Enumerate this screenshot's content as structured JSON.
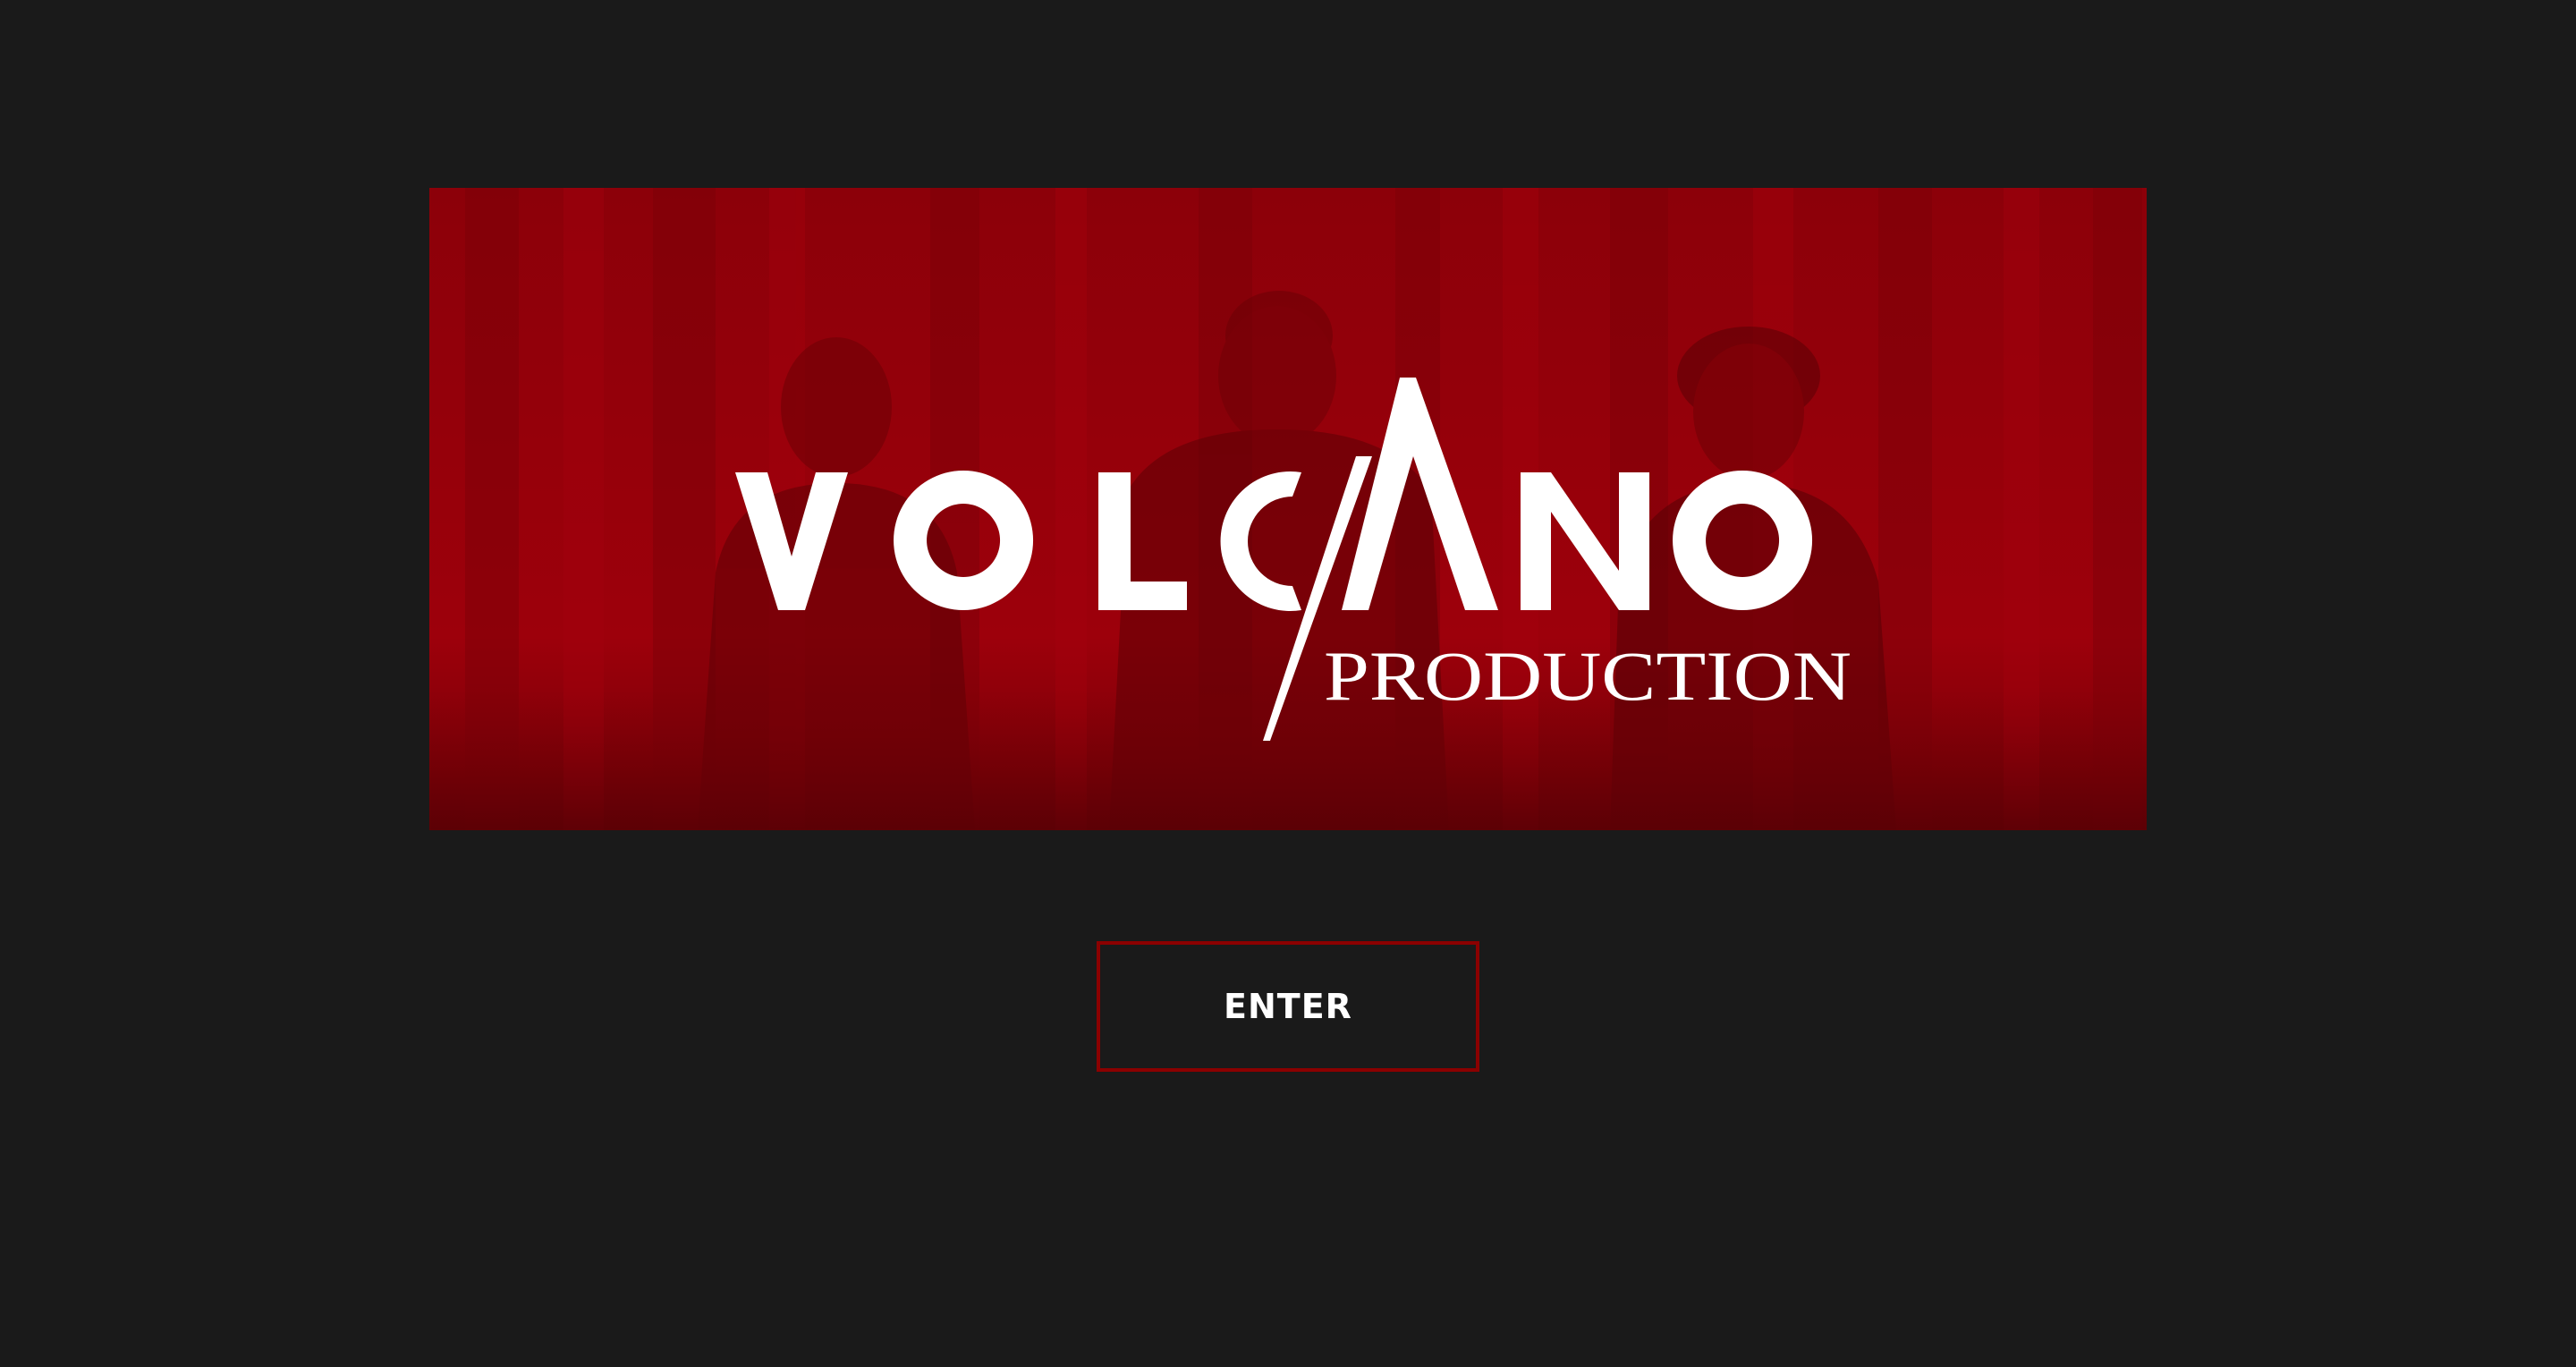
{
  "banner": {
    "logo": {
      "name": "VOLCANO",
      "subtitle": "PRODUCTION"
    },
    "overlay_color": "#9a0009"
  },
  "enter_button": {
    "label": "ENTER",
    "border_color": "#8b0000"
  },
  "colors": {
    "background": "#1a1a1a",
    "text": "#ffffff"
  }
}
